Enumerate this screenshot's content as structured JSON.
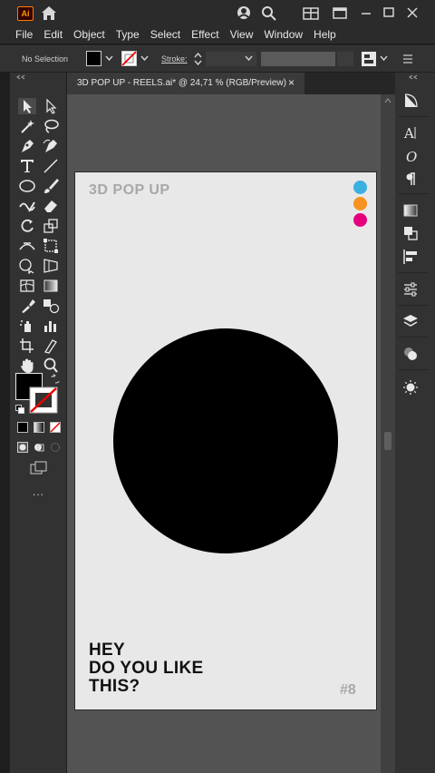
{
  "app": {
    "logo_text": "Ai",
    "accent_color": "#ff9a00"
  },
  "menu": [
    "File",
    "Edit",
    "Object",
    "Type",
    "Select",
    "Effect",
    "View",
    "Window",
    "Help"
  ],
  "controlbar": {
    "selection": "No Selection",
    "stroke_label": "Stroke:",
    "fill_color": "#000000"
  },
  "document_tab": {
    "title": "3D POP UP - REELS.ai* @ 24,71 % (RGB/Preview)",
    "close": "×"
  },
  "artboard": {
    "title": "3D POP UP",
    "dots": [
      "#3ab0df",
      "#f7931e",
      "#e6007e"
    ],
    "headline": [
      "HEY",
      "DO YOU LIKE",
      "THIS?"
    ],
    "number": "#8"
  },
  "toolbar": {
    "more": "..."
  },
  "icons": {
    "home": "home-icon",
    "user": "account-icon",
    "search": "search-icon",
    "arrange": "arrange-documents-icon",
    "window": "window-controls-icon"
  }
}
